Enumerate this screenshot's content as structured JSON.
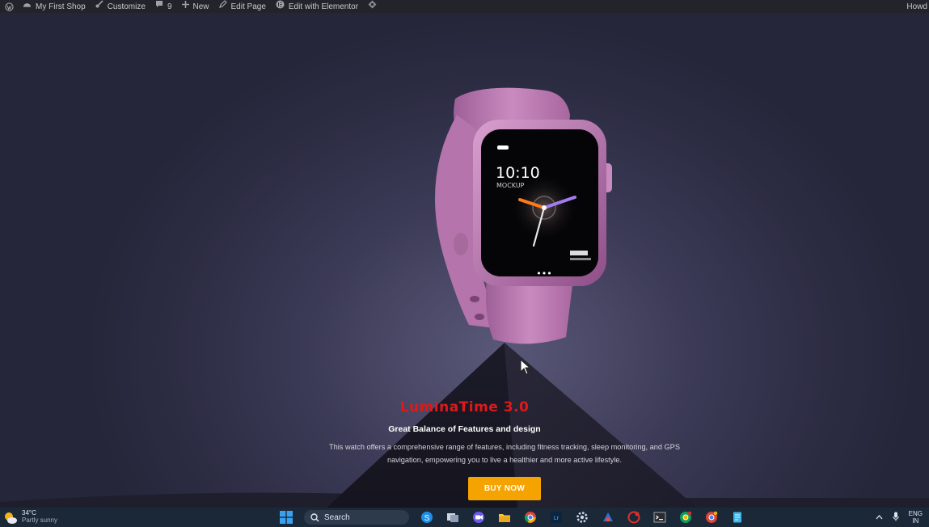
{
  "adminbar": {
    "site_name": "My First Shop",
    "customize": "Customize",
    "comments_count": "9",
    "new": "New",
    "edit_page": "Edit Page",
    "edit_elementor": "Edit with Elementor",
    "howdy": "Howd"
  },
  "hero": {
    "watch_time": "10:10",
    "watch_label": "MOCKUP",
    "watch_dots": "•••",
    "product_title": "LuminaTime 3.0",
    "subtitle": "Great Balance of Features and design",
    "description_line1": "This watch offers a comprehensive range of features, including fitness tracking, sleep monitoring, and GPS",
    "description_line2": "navigation, empowering you to live a healthier and more active lifestyle.",
    "buy_label": "BUY NOW"
  },
  "taskbar": {
    "temperature": "34°C",
    "condition": "Partly sunny",
    "search_label": "Search",
    "language_line1": "ENG",
    "language_line2": "IN"
  },
  "colors": {
    "title_red": "#e01818",
    "button_orange": "#f5a300",
    "watch_pink": "#c07bb5"
  }
}
